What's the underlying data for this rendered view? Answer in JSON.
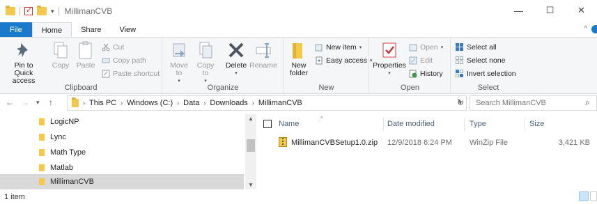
{
  "window": {
    "title": "MillimanCVB",
    "controls": {
      "minimize": "—",
      "maximize": "☐",
      "close": "✕"
    }
  },
  "ribbon_tabs": [
    "File",
    "Home",
    "Share",
    "View"
  ],
  "ribbon_collapse": "^",
  "clipboard": {
    "pin": "Pin to Quick access",
    "copy": "Copy",
    "paste": "Paste",
    "cut": "Cut",
    "copy_path": "Copy path",
    "paste_shortcut": "Paste shortcut",
    "label": "Clipboard"
  },
  "organize": {
    "move_to": "Move to",
    "copy_to": "Copy to",
    "delete": "Delete",
    "rename": "Rename",
    "label": "Organize"
  },
  "new": {
    "new_folder": "New folder",
    "new_item": "New item",
    "easy_access": "Easy access",
    "label": "New"
  },
  "open": {
    "properties": "Properties",
    "open": "Open",
    "edit": "Edit",
    "history": "History",
    "label": "Open"
  },
  "select": {
    "select_all": "Select all",
    "select_none": "Select none",
    "invert": "Invert selection",
    "label": "Select"
  },
  "address": {
    "crumbs": [
      "This PC",
      "Windows (C:)",
      "Data",
      "Downloads",
      "MillimanCVB"
    ],
    "search_placeholder": "Search MillimanCVB"
  },
  "nav_items": [
    "LogicNP",
    "Lync",
    "Math Type",
    "Matlab",
    "MillimanCVB"
  ],
  "columns": {
    "name": "Name",
    "date": "Date modified",
    "type": "Type",
    "size": "Size"
  },
  "files": [
    {
      "name": "MillimanCVBSetup1.0.zip",
      "date": "12/9/2018 6:24 PM",
      "type": "WinZip File",
      "size": "3,421 KB"
    }
  ],
  "status": {
    "item_count": "1 item"
  },
  "colors": {
    "file_tab": "#1979ca",
    "selected": "#d9d9d9",
    "folder": "#f2c94c"
  }
}
